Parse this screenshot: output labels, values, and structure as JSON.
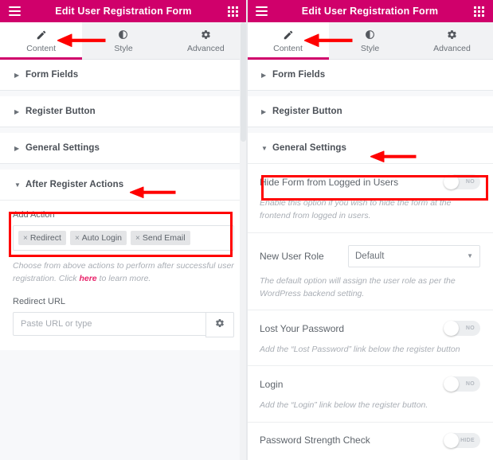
{
  "theme": {
    "accent": "#d0006b",
    "annotation": "#ff0000",
    "link": "#e8246b",
    "panel_bg": "#ffffff",
    "app_bg": "#f7f8fa"
  },
  "panels": [
    {
      "id": "left",
      "header": {
        "title": "Edit User Registration Form",
        "menu_icon": "hamburger-icon",
        "apps_icon": "grid-apps-icon"
      },
      "tabs": [
        {
          "label": "Content",
          "icon": "pencil-icon",
          "active": true
        },
        {
          "label": "Style",
          "icon": "contrast-circle-icon",
          "active": false
        },
        {
          "label": "Advanced",
          "icon": "gear-icon",
          "active": false
        }
      ],
      "sections": [
        {
          "title": "Form Fields",
          "open": false
        },
        {
          "title": "Register Button",
          "open": false
        },
        {
          "title": "General Settings",
          "open": false
        },
        {
          "title": "After Register Actions",
          "open": true
        }
      ],
      "after_register_actions": {
        "add_action_label": "Add Action",
        "tags": [
          {
            "remove_icon": "×",
            "label": "Redirect"
          },
          {
            "remove_icon": "×",
            "label": "Auto Login"
          },
          {
            "remove_icon": "×",
            "label": "Send Email"
          }
        ],
        "help_before": "Choose from above actions to perform after successful user registration. Click ",
        "help_link": "here",
        "help_after": " to learn more.",
        "redirect_url_label": "Redirect URL",
        "redirect_url_value": "",
        "redirect_url_placeholder": "Paste URL or type",
        "redirect_settings_icon": "gear-icon"
      }
    },
    {
      "id": "right",
      "header": {
        "title": "Edit User Registration Form",
        "menu_icon": "hamburger-icon",
        "apps_icon": "grid-apps-icon"
      },
      "tabs": [
        {
          "label": "Content",
          "icon": "pencil-icon",
          "active": true
        },
        {
          "label": "Style",
          "icon": "contrast-circle-icon",
          "active": false
        },
        {
          "label": "Advanced",
          "icon": "gear-icon",
          "active": false
        }
      ],
      "sections": [
        {
          "title": "Form Fields",
          "open": false
        },
        {
          "title": "Register Button",
          "open": false
        },
        {
          "title": "General Settings",
          "open": true
        }
      ],
      "general_settings": {
        "options": [
          {
            "title": "Hide Form from Logged in Users",
            "control": "toggle",
            "toggle_state": "NO",
            "description": "Enable this option if you wish to hide the form at the frontend from logged in users."
          },
          {
            "title": "New User Role",
            "control": "select",
            "select_value": "Default",
            "description": "The default option will assign the user role as per the WordPress backend setting."
          },
          {
            "title": "Lost Your Password",
            "control": "toggle",
            "toggle_state": "NO",
            "description": "Add the “Lost Password” link below the register button"
          },
          {
            "title": "Login",
            "control": "toggle",
            "toggle_state": "NO",
            "description": "Add the “Login” link below the register button."
          },
          {
            "title": "Password Strength Check",
            "control": "toggle",
            "toggle_state": "HIDE",
            "description": ""
          }
        ]
      }
    }
  ],
  "annotations": {
    "arrows": [
      {
        "name": "arrow-to-content-tab-left",
        "target": "Content tab (left panel)"
      },
      {
        "name": "arrow-to-after-register-actions",
        "target": "After Register Actions section"
      },
      {
        "name": "arrow-to-content-tab-right",
        "target": "Content tab (right panel)"
      },
      {
        "name": "arrow-to-general-settings",
        "target": "General Settings section"
      }
    ],
    "highlight_boxes": [
      {
        "name": "highlight-add-action-field",
        "target": "Add Action field with tags"
      },
      {
        "name": "highlight-hide-form-toggle",
        "target": "Hide Form from Logged in Users row"
      }
    ]
  }
}
